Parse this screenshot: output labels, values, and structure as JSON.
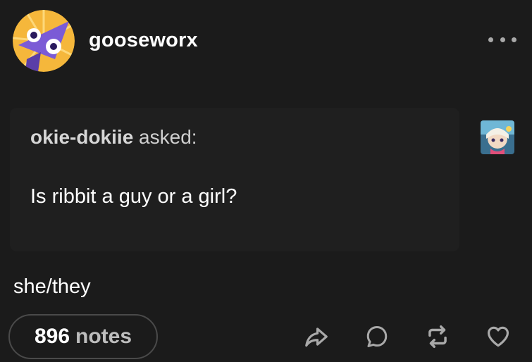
{
  "post": {
    "blog_name": "gooseworx",
    "ask": {
      "asker": "okie-dokiie",
      "asked_label": "asked:",
      "question": "Is ribbit a guy or a girl?"
    },
    "answer": "she/they",
    "notes": {
      "count": "896",
      "label": "notes"
    }
  },
  "icons": {
    "more": "more-horizontal-icon",
    "share": "share-arrow-icon",
    "reply": "reply-bubble-icon",
    "reblog": "reblog-icon",
    "like": "heart-icon"
  },
  "colors": {
    "background": "#1b1b1b",
    "ask_background": "#1f1f1f",
    "text": "#ffffff",
    "muted_text": "#bdbdbd",
    "icon": "#a9a9a9"
  }
}
